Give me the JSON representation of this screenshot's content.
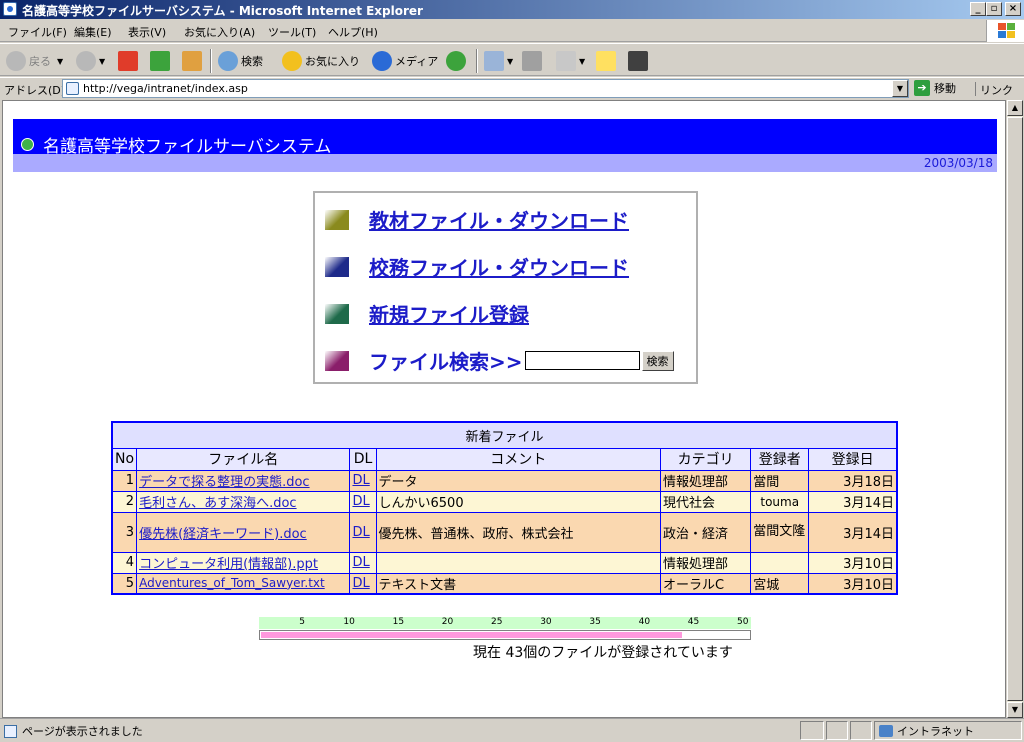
{
  "window": {
    "title": "名護高等学校ファイルサーバシステム - Microsoft Internet Explorer"
  },
  "menubar": {
    "items": [
      "ファイル(F)",
      "編集(E)",
      "表示(V)",
      "お気に入り(A)",
      "ツール(T)",
      "ヘルプ(H)"
    ]
  },
  "toolbar": {
    "back": "戻る",
    "search": "検索",
    "favorites": "お気に入り",
    "media": "メディア"
  },
  "addressbar": {
    "label": "アドレス(D)",
    "url": "http://vega/intranet/index.asp",
    "go": "移動",
    "links": "リンク"
  },
  "page": {
    "header_title": "名護高等学校ファイルサーバシステム",
    "date": "2003/03/18",
    "menu": [
      {
        "label": "教材ファイル・ダウンロード",
        "color": "#8a8a1e"
      },
      {
        "label": "校務ファイル・ダウンロード",
        "color": "#1e2a8a"
      },
      {
        "label": "新規ファイル登録",
        "color": "#1e6a4a"
      },
      {
        "label": "ファイル検索>>",
        "color": "#8a1e6a"
      }
    ],
    "search_button": "検索",
    "search_value": ""
  },
  "files": {
    "caption": "新着ファイル",
    "headers": [
      "No",
      "ファイル名",
      "DL",
      "コメント",
      "カテゴリ",
      "登録者",
      "登録日"
    ],
    "rows": [
      {
        "no": "1",
        "name": "データで探る整理の実態.doc",
        "dl": "DL",
        "comment": "データ",
        "category": "情報処理部",
        "user": "當間",
        "date": "3月18日"
      },
      {
        "no": "2",
        "name": "毛利さん、あす深海へ.doc",
        "dl": "DL",
        "comment": "しんかい6500",
        "category": "現代社会",
        "user": "touma",
        "date": "3月14日"
      },
      {
        "no": "3",
        "name": "優先株(経済キーワード).doc",
        "dl": "DL",
        "comment": "優先株、普通株、政府、株式会社",
        "category": "政治・経済",
        "user": "當間文隆",
        "date": "3月14日"
      },
      {
        "no": "4",
        "name": "コンピュータ利用(情報部).ppt",
        "dl": "DL",
        "comment": "",
        "category": "情報処理部",
        "user": "",
        "date": "3月10日"
      },
      {
        "no": "5",
        "name": "Adventures_of_Tom_Sawyer.txt",
        "dl": "DL",
        "comment": "テキスト文書",
        "category": "オーラルC",
        "user": "宮城",
        "date": "3月10日"
      }
    ]
  },
  "gauge": {
    "ticks": [
      "5",
      "10",
      "15",
      "20",
      "25",
      "30",
      "35",
      "40",
      "45",
      "50"
    ],
    "max": 50,
    "value": 43,
    "status_text": "現在 43個のファイルが登録されています"
  },
  "statusbar": {
    "message": "ページが表示されました",
    "zone": "イントラネット"
  }
}
